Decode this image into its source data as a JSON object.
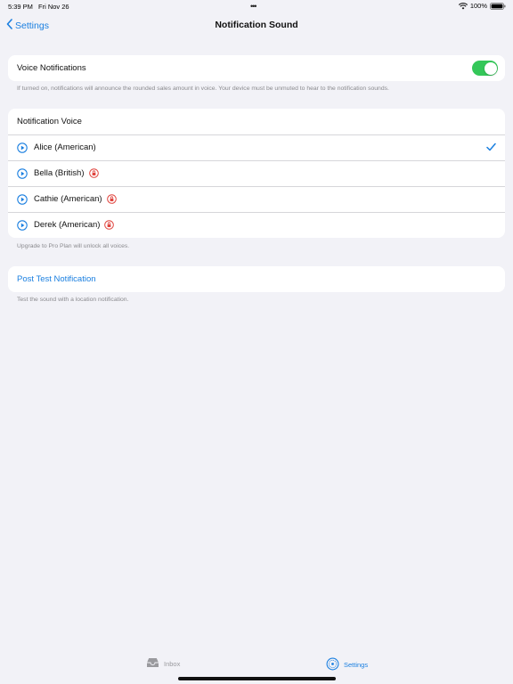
{
  "status_bar": {
    "time": "5:39 PM",
    "date": "Fri Nov 26",
    "battery": "100%"
  },
  "nav": {
    "back_label": "Settings",
    "title": "Notification Sound"
  },
  "voice_notifications": {
    "label": "Voice Notifications",
    "enabled": true,
    "footnote": "If turned on, notifications will announce the rounded sales amount in voice. Your device must be unmuted to hear to the notification sounds."
  },
  "notification_voice": {
    "header": "Notification Voice",
    "voices": [
      {
        "name": "Alice (American)",
        "selected": true,
        "locked": false
      },
      {
        "name": "Bella (British)",
        "selected": false,
        "locked": true
      },
      {
        "name": "Cathie (American)",
        "selected": false,
        "locked": true
      },
      {
        "name": "Derek (American)",
        "selected": false,
        "locked": true
      }
    ],
    "footnote": "Upgrade to Pro Plan will unlock all voices."
  },
  "test_notification": {
    "label": "Post Test Notification",
    "footnote": "Test the sound with a location notification."
  },
  "tab_bar": {
    "tabs": [
      {
        "label": "Inbox",
        "icon": "tray-icon",
        "active": false
      },
      {
        "label": "Settings",
        "icon": "gear-icon",
        "active": true
      }
    ]
  },
  "colors": {
    "accent": "#1a7fe0",
    "toggle_on": "#34c759",
    "lock": "#e0443e",
    "background": "#f2f2f7"
  }
}
